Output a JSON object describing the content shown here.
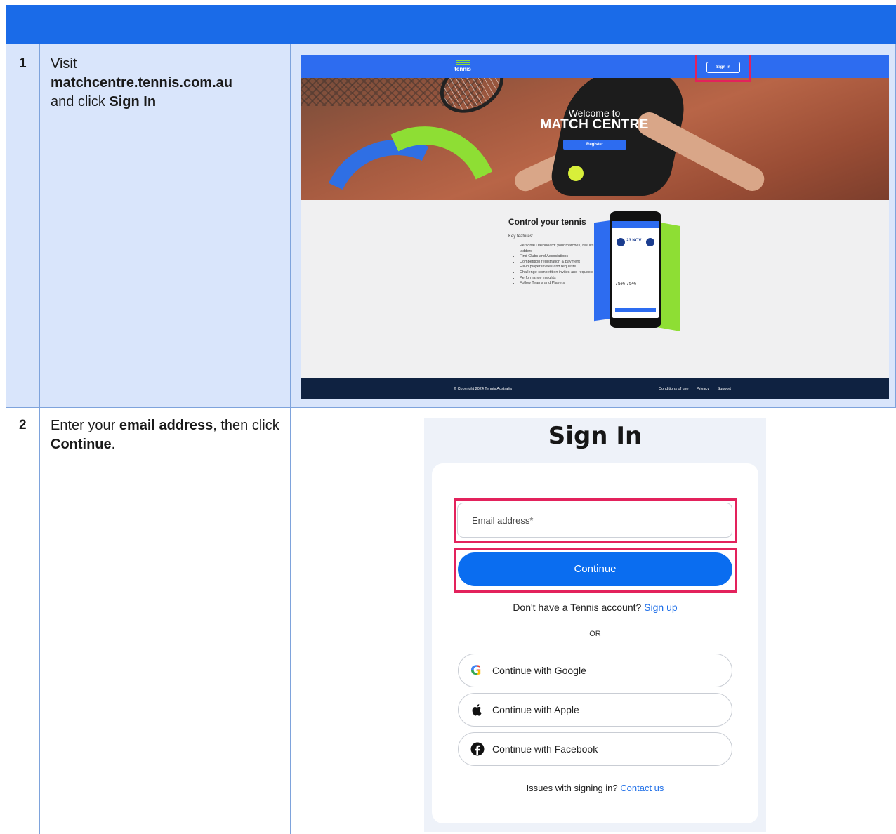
{
  "steps": [
    {
      "number": "1",
      "text_pre": "Visit ",
      "text_bold1": "matchcentre.tennis.com.au",
      "text_mid": " and click ",
      "text_bold2": "Sign In",
      "text_post": ""
    },
    {
      "number": "2",
      "text_pre": "Enter your ",
      "text_bold1": "email address",
      "text_mid": ", then click ",
      "text_bold2": "Continue",
      "text_post": "."
    }
  ],
  "match_centre": {
    "logo": "tennis",
    "sign_in_button": "Sign In",
    "welcome_line1": "Welcome to",
    "welcome_line2": "MATCH CENTRE",
    "register_button": "Register",
    "features_title": "Control your tennis",
    "features_subtitle": "Key features:",
    "features": [
      "Personal Dashboard: your matches, results & ladders",
      "Find Clubs and Associations",
      "Competition registration & payment",
      "Fill-in player invites and requests",
      "Challenge competition invites and requests",
      "Performance insights",
      "Follow Teams and Players"
    ],
    "phone_date": "23 NOV",
    "phone_score": "75%  75%",
    "footer_copyright": "© Copyright 2024 Tennis Australia",
    "footer_links": [
      "Conditions of use",
      "Privacy",
      "Support"
    ]
  },
  "sign_in": {
    "title": "Sign In",
    "email_placeholder": "Email address*",
    "continue_button": "Continue",
    "no_account_text": "Don't have a Tennis account?",
    "sign_up_link": "Sign up",
    "or_text": "OR",
    "social_buttons": [
      {
        "label": "Continue with Google",
        "icon": "google-icon"
      },
      {
        "label": "Continue with Apple",
        "icon": "apple-icon"
      },
      {
        "label": "Continue with Facebook",
        "icon": "facebook-icon"
      }
    ],
    "issues_text": "Issues with signing in?",
    "contact_link": "Contact us"
  },
  "colors": {
    "header_blue": "#1a6be8",
    "row1_background": "#d9e5fb",
    "highlight_red": "#e3225c",
    "continue_blue": "#0a6df0"
  }
}
